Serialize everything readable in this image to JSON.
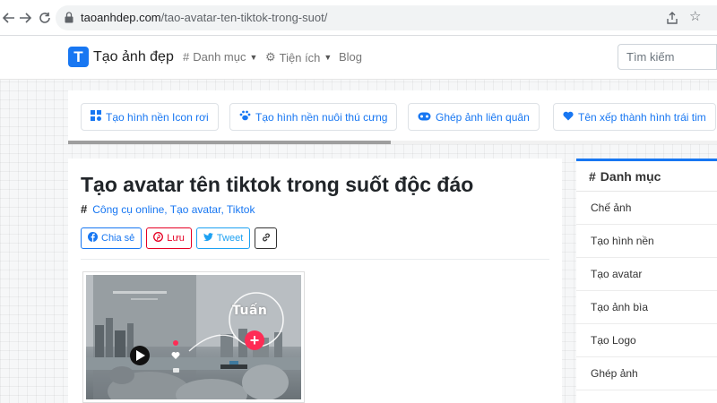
{
  "browser": {
    "url_host": "taoanhdep.com",
    "url_path": "/tao-avatar-ten-tiktok-trong-suot/",
    "back_icon": "arrow-left-icon",
    "forward_icon": "arrow-right-icon",
    "reload_icon": "reload-icon"
  },
  "navbar": {
    "logo_letter": "T",
    "brand": "Tạo ảnh đẹp",
    "items": [
      {
        "icon": "#",
        "label": "Danh mục"
      },
      {
        "icon": "⚙",
        "label": "Tiện ích"
      },
      {
        "label": "Blog"
      }
    ],
    "search_placeholder": "Tìm kiếm"
  },
  "tools": [
    {
      "label": "Tạo hình nền Icon rơi",
      "icon": "♱"
    },
    {
      "label": "Tạo hình nền nuôi thú cưng",
      "icon": "🐾"
    },
    {
      "label": "Ghép ảnh liên quân",
      "icon": "∞"
    },
    {
      "label": "Tên xếp thành hình trái tim",
      "icon": "♥"
    }
  ],
  "article": {
    "title": "Tạo avatar tên tiktok trong suốt độc đáo",
    "tags_hash": "#",
    "tags": "Công cụ online, Tạo avatar, Tiktok",
    "share": {
      "facebook": "Chia sẻ",
      "pinterest": "Lưu",
      "twitter": "Tweet"
    },
    "video_overlay_text": "Tuấn"
  },
  "sidebar": {
    "title": "Danh mục",
    "hash": "#",
    "items": [
      "Chế ảnh",
      "Tạo hình nền",
      "Tạo avatar",
      "Tạo ảnh bìa",
      "Tạo Logo",
      "Ghép ảnh"
    ]
  },
  "colors": {
    "brand_blue": "#1877f2",
    "pinterest_red": "#e60023",
    "twitter_blue": "#1da1f2",
    "tiktok_pink": "#fe2c55"
  }
}
